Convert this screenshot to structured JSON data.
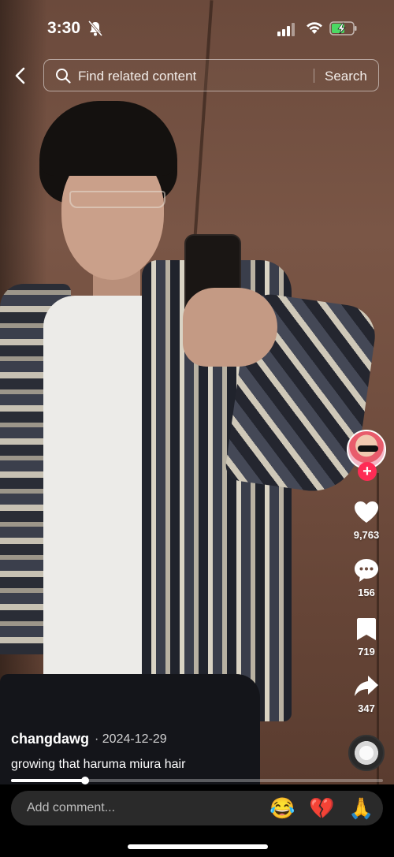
{
  "status_bar": {
    "time": "3:30",
    "icons": [
      "bell-slash-icon",
      "signal-icon",
      "wifi-icon",
      "battery-charging-icon"
    ],
    "battery_color": "#4cd964"
  },
  "search": {
    "placeholder": "Find related content",
    "button_label": "Search"
  },
  "rail": {
    "likes": "9,763",
    "comments": "156",
    "saves": "719",
    "shares": "347",
    "follow_color": "#fe2c55"
  },
  "post": {
    "username": "changdawg",
    "date": "· 2024-12-29",
    "caption": "growing that haruma miura hair",
    "progress": 0.2
  },
  "comment_bar": {
    "placeholder": "Add comment...",
    "emojis": [
      "😂",
      "💔",
      "🙏"
    ]
  }
}
